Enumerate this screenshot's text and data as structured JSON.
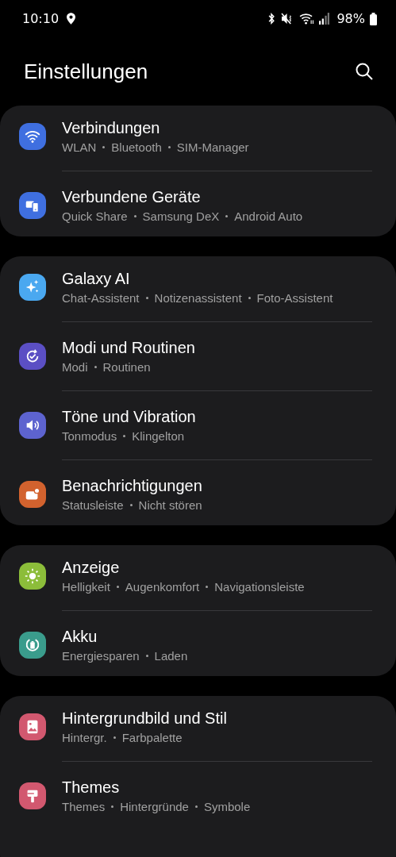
{
  "status_bar": {
    "time": "10:10",
    "battery": "98%"
  },
  "header": {
    "title": "Einstellungen"
  },
  "groups": [
    {
      "items": [
        {
          "kind": "wifi",
          "color": "#3f6fe0",
          "title": "Verbindungen",
          "details": [
            "WLAN",
            "Bluetooth",
            "SIM-Manager"
          ]
        },
        {
          "kind": "devices",
          "color": "#3f6fe0",
          "title": "Verbundene Geräte",
          "details": [
            "Quick Share",
            "Samsung DeX",
            "Android Auto"
          ]
        }
      ]
    },
    {
      "items": [
        {
          "kind": "sparkle",
          "color": "#4aa8f0",
          "title": "Galaxy AI",
          "details": [
            "Chat-Assistent",
            "Notizenassistent",
            "Foto-Assistent"
          ]
        },
        {
          "kind": "routine",
          "color": "#5b4fc4",
          "title": "Modi und Routinen",
          "details": [
            "Modi",
            "Routinen"
          ]
        },
        {
          "kind": "sound",
          "color": "#5d63cf",
          "title": "Töne und Vibration",
          "details": [
            "Tonmodus",
            "Klingelton"
          ]
        },
        {
          "kind": "notification",
          "color": "#d2622e",
          "title": "Benachrichtigungen",
          "details": [
            "Statusleiste",
            "Nicht stören"
          ]
        }
      ]
    },
    {
      "items": [
        {
          "kind": "sun",
          "color": "#8cbd3a",
          "title": "Anzeige",
          "details": [
            "Helligkeit",
            "Augenkomfort",
            "Navigationsleiste"
          ]
        },
        {
          "kind": "battery",
          "color": "#3a9c8c",
          "title": "Akku",
          "details": [
            "Energiesparen",
            "Laden"
          ]
        }
      ]
    },
    {
      "items": [
        {
          "kind": "image",
          "color": "#d2586f",
          "title": "Hintergrundbild und Stil",
          "details": [
            "Hintergr.",
            "Farbpalette"
          ]
        },
        {
          "kind": "brush",
          "color": "#d2586f",
          "title": "Themes",
          "details": [
            "Themes",
            "Hintergründe",
            "Symbole"
          ]
        }
      ]
    }
  ]
}
